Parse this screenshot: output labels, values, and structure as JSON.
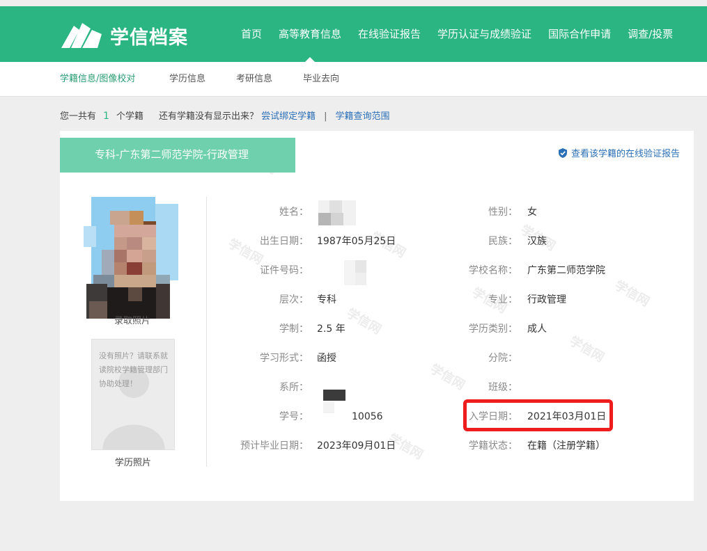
{
  "header": {
    "logo_text": "学信档案",
    "nav": [
      "首页",
      "高等教育信息",
      "在线验证报告",
      "学历认证与成绩验证",
      "国际合作申请",
      "调查/投票"
    ],
    "active_nav": "高等教育信息",
    "brand_color": "#2bb583"
  },
  "subnav": {
    "items": [
      "学籍信息/图像校对",
      "学历信息",
      "考研信息",
      "毕业去向"
    ],
    "active": "学籍信息/图像校对"
  },
  "summary": {
    "prefix": "您一共有",
    "count": "1",
    "suffix": "个学籍",
    "question": "还有学籍没有显示出来？",
    "bind_link": "尝试绑定学籍",
    "separator": "|",
    "scope_link": "学籍查询范围"
  },
  "record": {
    "title": "专科-广东第二师范学院-行政管理",
    "verify_link": "查看该学籍的在线验证报告",
    "photo1_caption": "录取照片",
    "no_photo_text": "没有照片？请联系就读院校学籍管理部门协助处理！",
    "photo2_caption": "学历照片",
    "fields_left": [
      {
        "label": "姓名：",
        "value": ""
      },
      {
        "label": "出生日期：",
        "value": "1987年05月25日"
      },
      {
        "label": "证件号码：",
        "value": ""
      },
      {
        "label": "层次：",
        "value": "专科"
      },
      {
        "label": "学制：",
        "value": "2.5 年"
      },
      {
        "label": "学习形式：",
        "value": "函授"
      },
      {
        "label": "系所：",
        "value": ""
      },
      {
        "label": "学号：",
        "value": "10056"
      },
      {
        "label": "预计毕业日期：",
        "value": "2023年09月01日"
      }
    ],
    "fields_right": [
      {
        "label": "性别：",
        "value": "女"
      },
      {
        "label": "民族：",
        "value": "汉族"
      },
      {
        "label": "学校名称：",
        "value": "广东第二师范学院"
      },
      {
        "label": "专业：",
        "value": "行政管理"
      },
      {
        "label": "学历类别：",
        "value": "成人"
      },
      {
        "label": "分院：",
        "value": ""
      },
      {
        "label": "班级：",
        "value": ""
      },
      {
        "label": "入学日期：",
        "value": "2021年03月01日"
      },
      {
        "label": "学籍状态：",
        "value": "在籍（注册学籍）"
      }
    ],
    "highlight_color": "#ee1c1c",
    "watermark_text": "学信网"
  }
}
